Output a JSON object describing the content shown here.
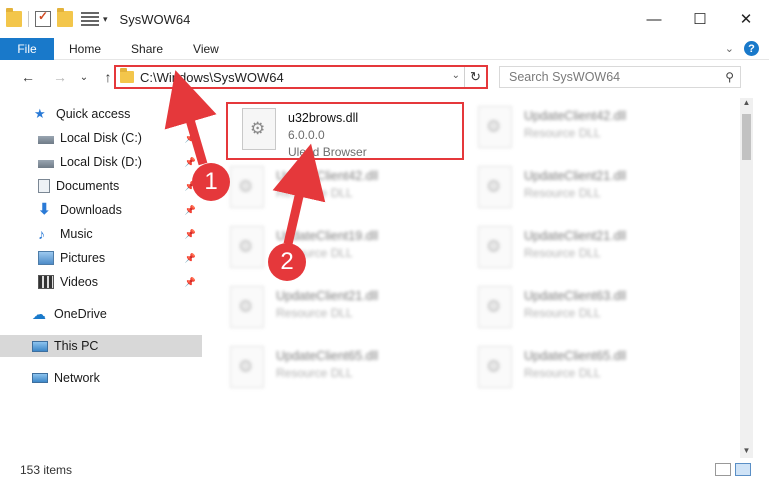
{
  "window": {
    "title": "SysWOW64",
    "minimize_glyph": "—",
    "maximize_glyph": "☐",
    "close_glyph": "✕"
  },
  "ribbon": {
    "file_tab": "File",
    "tabs": [
      "Home",
      "Share",
      "View"
    ],
    "help": "?"
  },
  "nav": {
    "back": "←",
    "forward": "→",
    "recent": "⌄",
    "up": "↑",
    "address": "C:\\Windows\\SysWOW64",
    "refresh": "↻",
    "search_placeholder": "Search SysWOW64"
  },
  "sidebar": {
    "items": [
      {
        "label": "Quick access",
        "icon": "star-icon",
        "pinned": false
      },
      {
        "label": "Local Disk (C:)",
        "icon": "drive-icon",
        "pinned": true
      },
      {
        "label": "Local Disk (D:)",
        "icon": "drive-icon",
        "pinned": true
      },
      {
        "label": "Documents",
        "icon": "documents-icon",
        "pinned": true
      },
      {
        "label": "Downloads",
        "icon": "download-icon",
        "pinned": true
      },
      {
        "label": "Music",
        "icon": "music-icon",
        "pinned": true
      },
      {
        "label": "Pictures",
        "icon": "pictures-icon",
        "pinned": true
      },
      {
        "label": "Videos",
        "icon": "videos-icon",
        "pinned": true
      },
      {
        "label": "OneDrive",
        "icon": "cloud-icon",
        "pinned": false
      },
      {
        "label": "This PC",
        "icon": "computer-icon",
        "pinned": false,
        "selected": true
      },
      {
        "label": "Network",
        "icon": "network-icon",
        "pinned": false
      }
    ]
  },
  "files": [
    {
      "name": "u32brows.dll",
      "line2": "6.0.0.0",
      "line3": "Ulead Browser"
    },
    {
      "name": "UpdateClient42.dll",
      "line2": "Resource DLL"
    },
    {
      "name": "UpdateClient42.dll",
      "line2": "Resource DLL"
    },
    {
      "name": "UpdateClient21.dll",
      "line2": "Resource DLL"
    },
    {
      "name": "UpdateClient19.dll",
      "line2": "Resource DLL"
    },
    {
      "name": "UpdateClient21.dll",
      "line2": "Resource DLL"
    },
    {
      "name": "UpdateClient21.dll",
      "line2": "Resource DLL"
    },
    {
      "name": "UpdateClient63.dll",
      "line2": "Resource DLL"
    },
    {
      "name": "UpdateClient65.dll",
      "line2": "Resource DLL"
    },
    {
      "name": "UpdateClient65.dll",
      "line2": "Resource DLL"
    }
  ],
  "status": {
    "item_count": "153 items"
  },
  "annotations": {
    "step1": "1",
    "step2": "2",
    "color": "#e5383b"
  },
  "colors": {
    "accent": "#1979ca",
    "highlight": "#e5383b",
    "folder": "#f3c64b"
  }
}
